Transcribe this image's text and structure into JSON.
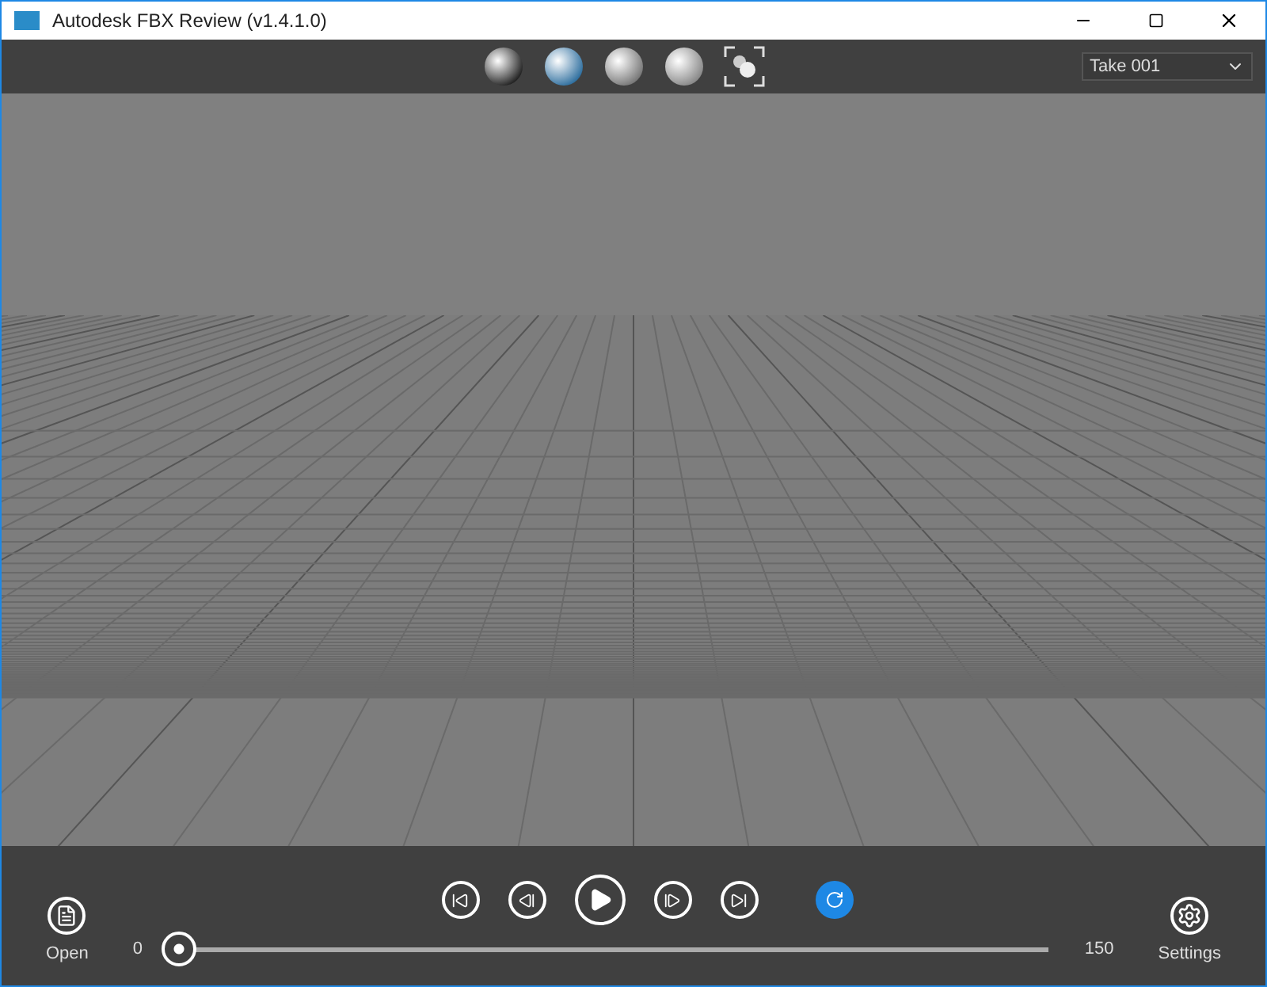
{
  "window": {
    "title": "Autodesk FBX Review (v1.4.1.0)"
  },
  "toolbar": {
    "take": {
      "value": "Take 001"
    }
  },
  "playback": {
    "loop": {
      "on": true
    }
  },
  "timeline": {
    "start": "0",
    "end": "150",
    "level": 0
  },
  "side_buttons": [
    {
      "kind": "open",
      "label": "Open"
    },
    {
      "kind": "settings",
      "label": "Settings"
    }
  ]
}
